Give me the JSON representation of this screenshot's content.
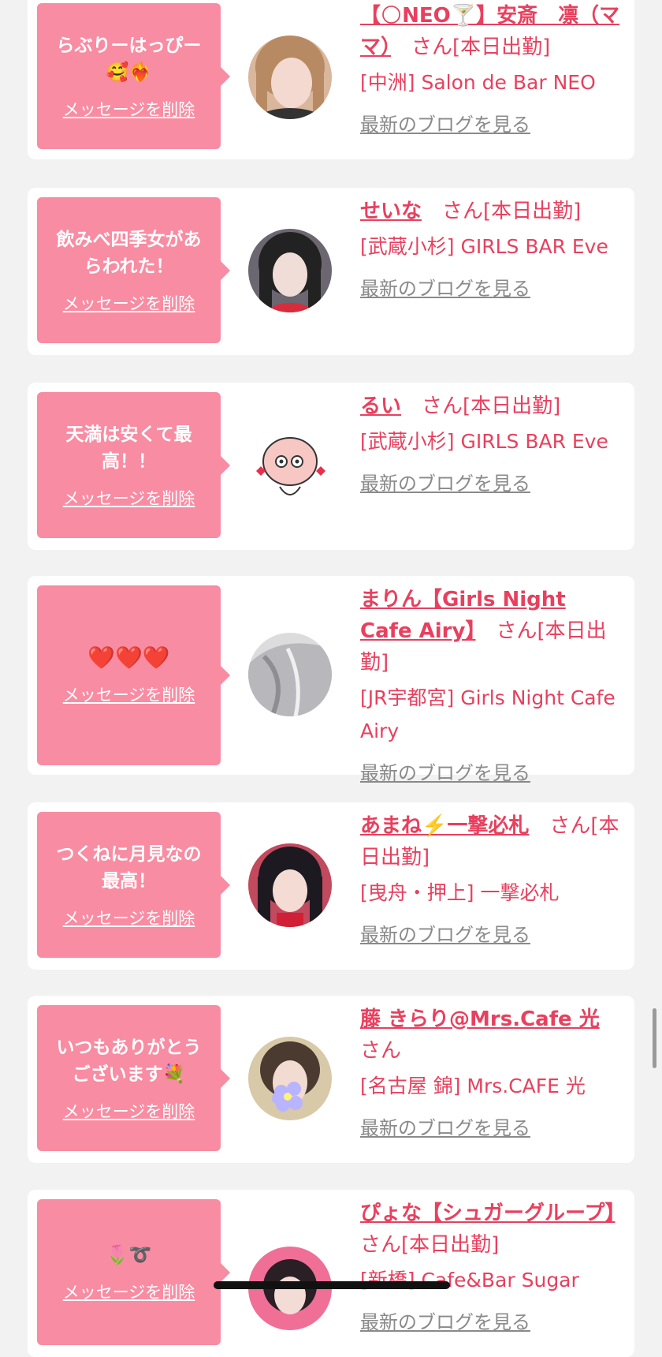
{
  "colors": {
    "accent": "#e8405e",
    "bubble": "#f88ca2",
    "bg": "#f2f2f2"
  },
  "entries": [
    {
      "message": "らぶりーはっぴー🥰❤️‍🔥",
      "delete_label": "メッセージを削除",
      "name": "【🌕NEO🍸】安斎　凛（ママ）",
      "san": "さん[本日出勤]",
      "shop": "[中洲] Salon de Bar NEO",
      "blog_label": "最新のブログを見る",
      "avatar": "photo-hair-light"
    },
    {
      "message": "飲みべ四季女があらわれた！",
      "delete_label": "メッセージを削除",
      "name": "せいな",
      "san": "さん[本日出勤]",
      "shop": "[武蔵小杉] GIRLS BAR Eve",
      "blog_label": "最新のブログを見る",
      "avatar": "photo-hair-dark"
    },
    {
      "message": "天満は安くて最高！！",
      "delete_label": "メッセージを削除",
      "name": "るい",
      "san": "さん[本日出勤]",
      "shop": "[武蔵小杉] GIRLS BAR Eve",
      "blog_label": "最新のブログを見る",
      "avatar": "peach-character"
    },
    {
      "message": "❤️❤️❤️",
      "delete_label": "メッセージを削除",
      "name": "まりん【Girls Night Cafe Airy】",
      "san": "さん[本日出勤]",
      "shop": "[JR宇都宮] Girls Night Cafe Airy",
      "blog_label": "最新のブログを見る",
      "avatar": "photo-hair-gray"
    },
    {
      "message": "つくねに月見なの最高！",
      "delete_label": "メッセージを削除",
      "name": "あまね⚡️一撃必札",
      "san": "さん[本日出勤]",
      "shop": "[曳舟・押上] 一撃必札",
      "blog_label": "最新のブログを見る",
      "avatar": "photo-hair-dark"
    },
    {
      "message": "いつもありがとうございます💐",
      "delete_label": "メッセージを削除",
      "name": "藤 きらり@Mrs.Cafe 光",
      "san": "さん",
      "shop": "[名古屋 錦] Mrs.CAFE 光",
      "blog_label": "最新のブログを見る",
      "avatar": "photo-flower-face"
    },
    {
      "message": "🌷➰",
      "delete_label": "メッセージを削除",
      "name": "ぴょな【シュガーグループ】",
      "san": "さん[本日出勤]",
      "shop": "[新橋] Cafe&Bar Sugar",
      "blog_label": "最新のブログを見る",
      "avatar": "photo-pink"
    }
  ]
}
